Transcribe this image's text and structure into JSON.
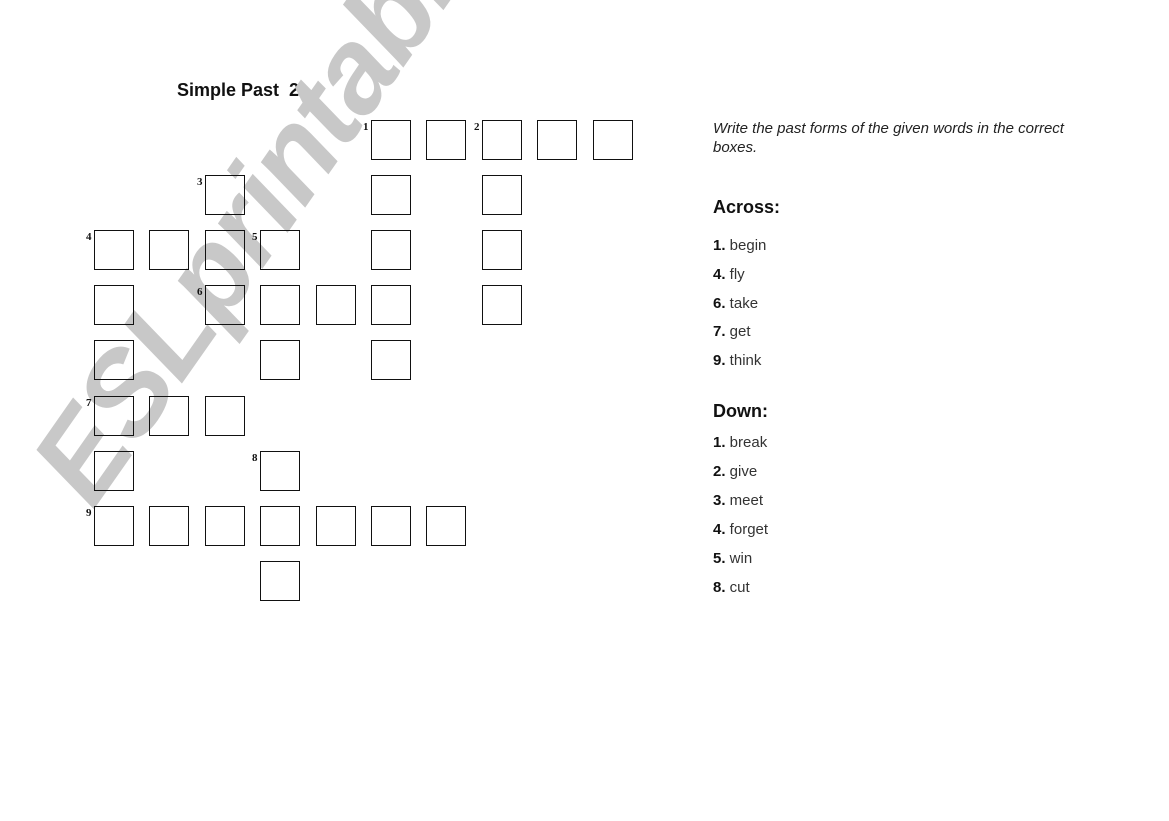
{
  "worksheet": {
    "title": "Simple Past  2",
    "instructions": "Write the past forms of the given words in the correct boxes.",
    "watermark": "ESLprintables.com"
  },
  "crossword": {
    "cells": [
      {
        "col": 5,
        "row": 0,
        "number": "1"
      },
      {
        "col": 6,
        "row": 0
      },
      {
        "col": 7,
        "row": 0,
        "number": "2"
      },
      {
        "col": 8,
        "row": 0
      },
      {
        "col": 9,
        "row": 0
      },
      {
        "col": 2,
        "row": 1,
        "number": "3"
      },
      {
        "col": 5,
        "row": 1
      },
      {
        "col": 7,
        "row": 1
      },
      {
        "col": 0,
        "row": 2,
        "number": "4"
      },
      {
        "col": 1,
        "row": 2
      },
      {
        "col": 2,
        "row": 2
      },
      {
        "col": 3,
        "row": 2,
        "number": "5"
      },
      {
        "col": 5,
        "row": 2
      },
      {
        "col": 7,
        "row": 2
      },
      {
        "col": 0,
        "row": 3
      },
      {
        "col": 2,
        "row": 3,
        "number": "6"
      },
      {
        "col": 3,
        "row": 3
      },
      {
        "col": 4,
        "row": 3
      },
      {
        "col": 5,
        "row": 3
      },
      {
        "col": 7,
        "row": 3
      },
      {
        "col": 0,
        "row": 4
      },
      {
        "col": 3,
        "row": 4
      },
      {
        "col": 5,
        "row": 4
      },
      {
        "col": 0,
        "row": 5,
        "number": "7"
      },
      {
        "col": 1,
        "row": 5
      },
      {
        "col": 2,
        "row": 5
      },
      {
        "col": 0,
        "row": 6
      },
      {
        "col": 3,
        "row": 6,
        "number": "8"
      },
      {
        "col": 0,
        "row": 7,
        "number": "9"
      },
      {
        "col": 1,
        "row": 7
      },
      {
        "col": 2,
        "row": 7
      },
      {
        "col": 3,
        "row": 7
      },
      {
        "col": 4,
        "row": 7
      },
      {
        "col": 5,
        "row": 7
      },
      {
        "col": 6,
        "row": 7
      },
      {
        "col": 3,
        "row": 8
      }
    ]
  },
  "clues": {
    "across_heading": "Across:",
    "across": [
      {
        "num": "1.",
        "word": "begin"
      },
      {
        "num": "4.",
        "word": "fly"
      },
      {
        "num": "6.",
        "word": "take"
      },
      {
        "num": "7.",
        "word": "get"
      },
      {
        "num": "9.",
        "word": "think"
      }
    ],
    "down_heading": "Down:",
    "down": [
      {
        "num": "1.",
        "word": "break"
      },
      {
        "num": "2.",
        "word": "give"
      },
      {
        "num": "3.",
        "word": "meet"
      },
      {
        "num": "4.",
        "word": "forget"
      },
      {
        "num": "5.",
        "word": "win"
      },
      {
        "num": "8.",
        "word": "cut"
      }
    ]
  }
}
